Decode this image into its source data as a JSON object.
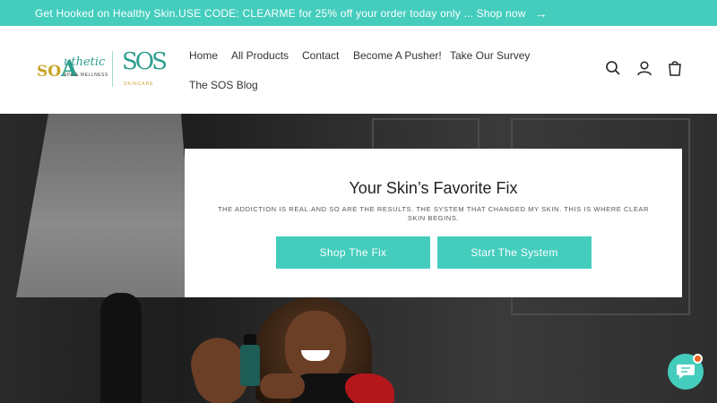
{
  "announcement": {
    "text": "Get Hooked on Healthy Skin.USE CODE: CLEARME for 25% off your order today only ... Shop now",
    "arrow_icon": "arrow-right-icon",
    "bg_color": "#44cdbd"
  },
  "logo": {
    "brand_prefix": "SO",
    "brand_letter": "A",
    "brand_script": "uthetic",
    "brand_tagline": "SPA & WELLNESS",
    "sos_mark": "SOS",
    "sos_sub": "SKINCARE"
  },
  "nav": {
    "items": [
      "Home",
      "All Products",
      "Contact",
      "Become A Pusher!",
      "Take Our Survey",
      "The SOS Blog"
    ]
  },
  "header_icons": [
    "search-icon",
    "account-icon",
    "cart-icon"
  ],
  "hero": {
    "heading": "Your Skin’s Favorite Fix",
    "subtext": "THE ADDICTION IS REAL.AND SO ARE THE RESULTS. THE SYSTEM THAT CHANGED MY SKIN. THIS IS WHERE CLEAR SKIN BEGINS.",
    "button_primary": "Shop The Fix",
    "button_secondary": "Start The System",
    "accent_color": "#44cdbd"
  },
  "chat": {
    "icon": "chat-bubble-icon",
    "badge_color": "#f26522"
  }
}
